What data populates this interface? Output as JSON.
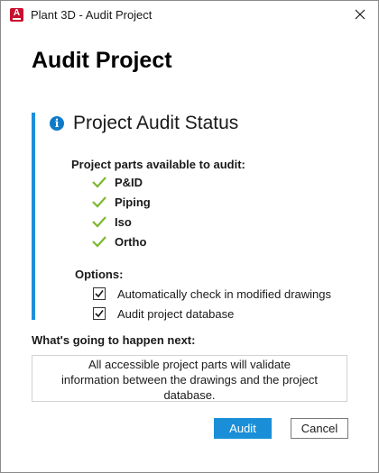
{
  "window": {
    "title": "Plant 3D - Audit Project",
    "app_icon_letter": "A",
    "close_icon": "close-icon"
  },
  "heading": "Audit Project",
  "status": {
    "title": "Project Audit Status",
    "icon": "info-icon",
    "parts_label": "Project parts available to audit:",
    "parts": [
      {
        "name": "P&ID",
        "checked": true
      },
      {
        "name": "Piping",
        "checked": true
      },
      {
        "name": "Iso",
        "checked": true
      },
      {
        "name": "Ortho",
        "checked": true
      }
    ],
    "options_label": "Options:",
    "options": [
      {
        "label": "Automatically check in modified drawings",
        "checked": true
      },
      {
        "label": "Audit project database",
        "checked": true
      }
    ]
  },
  "next": {
    "label": "What's going to happen next:",
    "lines": [
      "All accessible project parts will validate",
      "information between the drawings and the project",
      "database."
    ]
  },
  "buttons": {
    "audit": "Audit",
    "cancel": "Cancel"
  },
  "colors": {
    "accent": "#1a8fd8",
    "check_green": "#7cb82f",
    "app_red": "#c8102e"
  }
}
